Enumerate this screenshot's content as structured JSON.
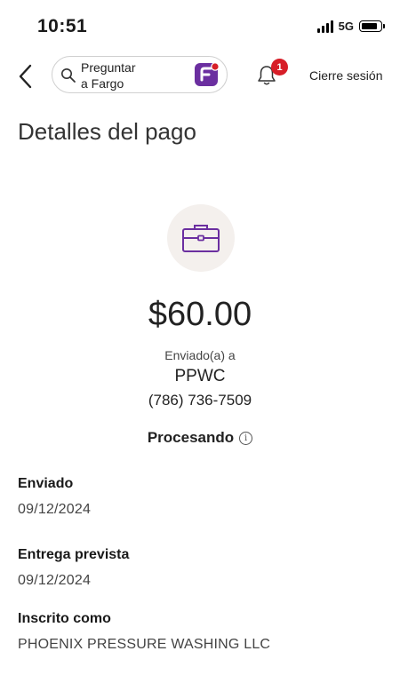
{
  "status_bar": {
    "time": "10:51",
    "network": "5G",
    "battery_level": 0.8
  },
  "header": {
    "search_placeholder": "Preguntar\na Fargo",
    "notification_count": "1",
    "logout_label": "Cierre sesión"
  },
  "page": {
    "title": "Detalles del pago"
  },
  "payment": {
    "amount": "$60.00",
    "sent_to_label": "Enviado(a) a",
    "recipient": "PPWC",
    "phone": "(786) 736-7509",
    "status": "Procesando"
  },
  "details": [
    {
      "label": "Enviado",
      "value": "09/12/2024"
    },
    {
      "label": "Entrega prevista",
      "value": "09/12/2024"
    },
    {
      "label": "Inscrito como",
      "value": "PHOENIX PRESSURE WASHING LLC"
    }
  ],
  "colors": {
    "accent_purple": "#6b2fa0",
    "badge_red": "#d71e28",
    "icon_bg": "#f4f0ed"
  },
  "icons": [
    "back-chevron-icon",
    "search-icon",
    "fargo-logo-icon",
    "bell-icon",
    "briefcase-icon",
    "info-icon"
  ]
}
